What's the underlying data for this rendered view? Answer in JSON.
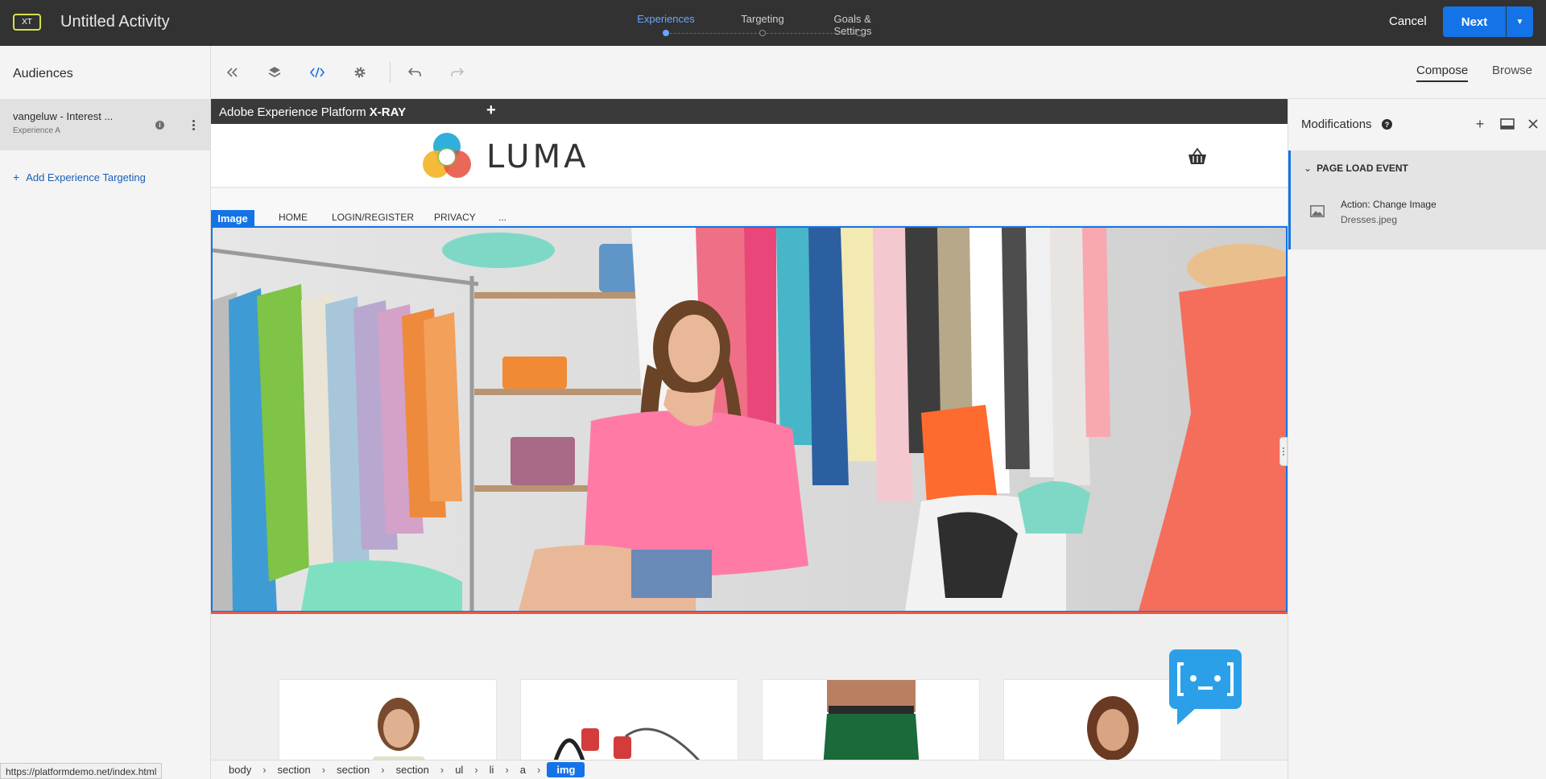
{
  "topbar": {
    "badge": "XT",
    "title": "Untitled Activity",
    "steps": [
      {
        "label": "Experiences",
        "active": true
      },
      {
        "label": "Targeting",
        "active": false
      },
      {
        "label": "Goals & Settings",
        "active": false
      }
    ],
    "cancel_label": "Cancel",
    "next_label": "Next"
  },
  "left_panel": {
    "title": "Audiences",
    "experience": {
      "name": "vangeluw - Interest ...",
      "subtitle": "Experience A"
    },
    "add_targeting_label": "Add Experience Targeting"
  },
  "toolbar": {
    "tools": [
      "collapse-icon",
      "layers-icon",
      "code-icon",
      "gear-icon",
      "undo-icon",
      "redo-icon"
    ],
    "compose_label": "Compose",
    "browse_label": "Browse"
  },
  "canvas": {
    "xray_title_prefix": "Adobe Experience Platform",
    "xray_title_bold": "X-RAY",
    "brand": "LUMA",
    "nav": [
      "HOME",
      "LOGIN/REGISTER",
      "PRIVACY",
      "..."
    ],
    "selected_tag": "Image"
  },
  "breadcrumb": [
    "body",
    "section",
    "section",
    "section",
    "ul",
    "li",
    "a",
    "img"
  ],
  "status_url": "https://platformdemo.net/index.html",
  "right_panel": {
    "title": "Modifications",
    "event_title": "PAGE LOAD EVENT",
    "action_title": "Action: Change Image",
    "action_file": "Dresses.jpeg"
  },
  "colors": {
    "accent": "#1473e6",
    "topbar_bg": "#323232",
    "active_step": "#66a8ff",
    "badge_border": "#d6e04c"
  }
}
